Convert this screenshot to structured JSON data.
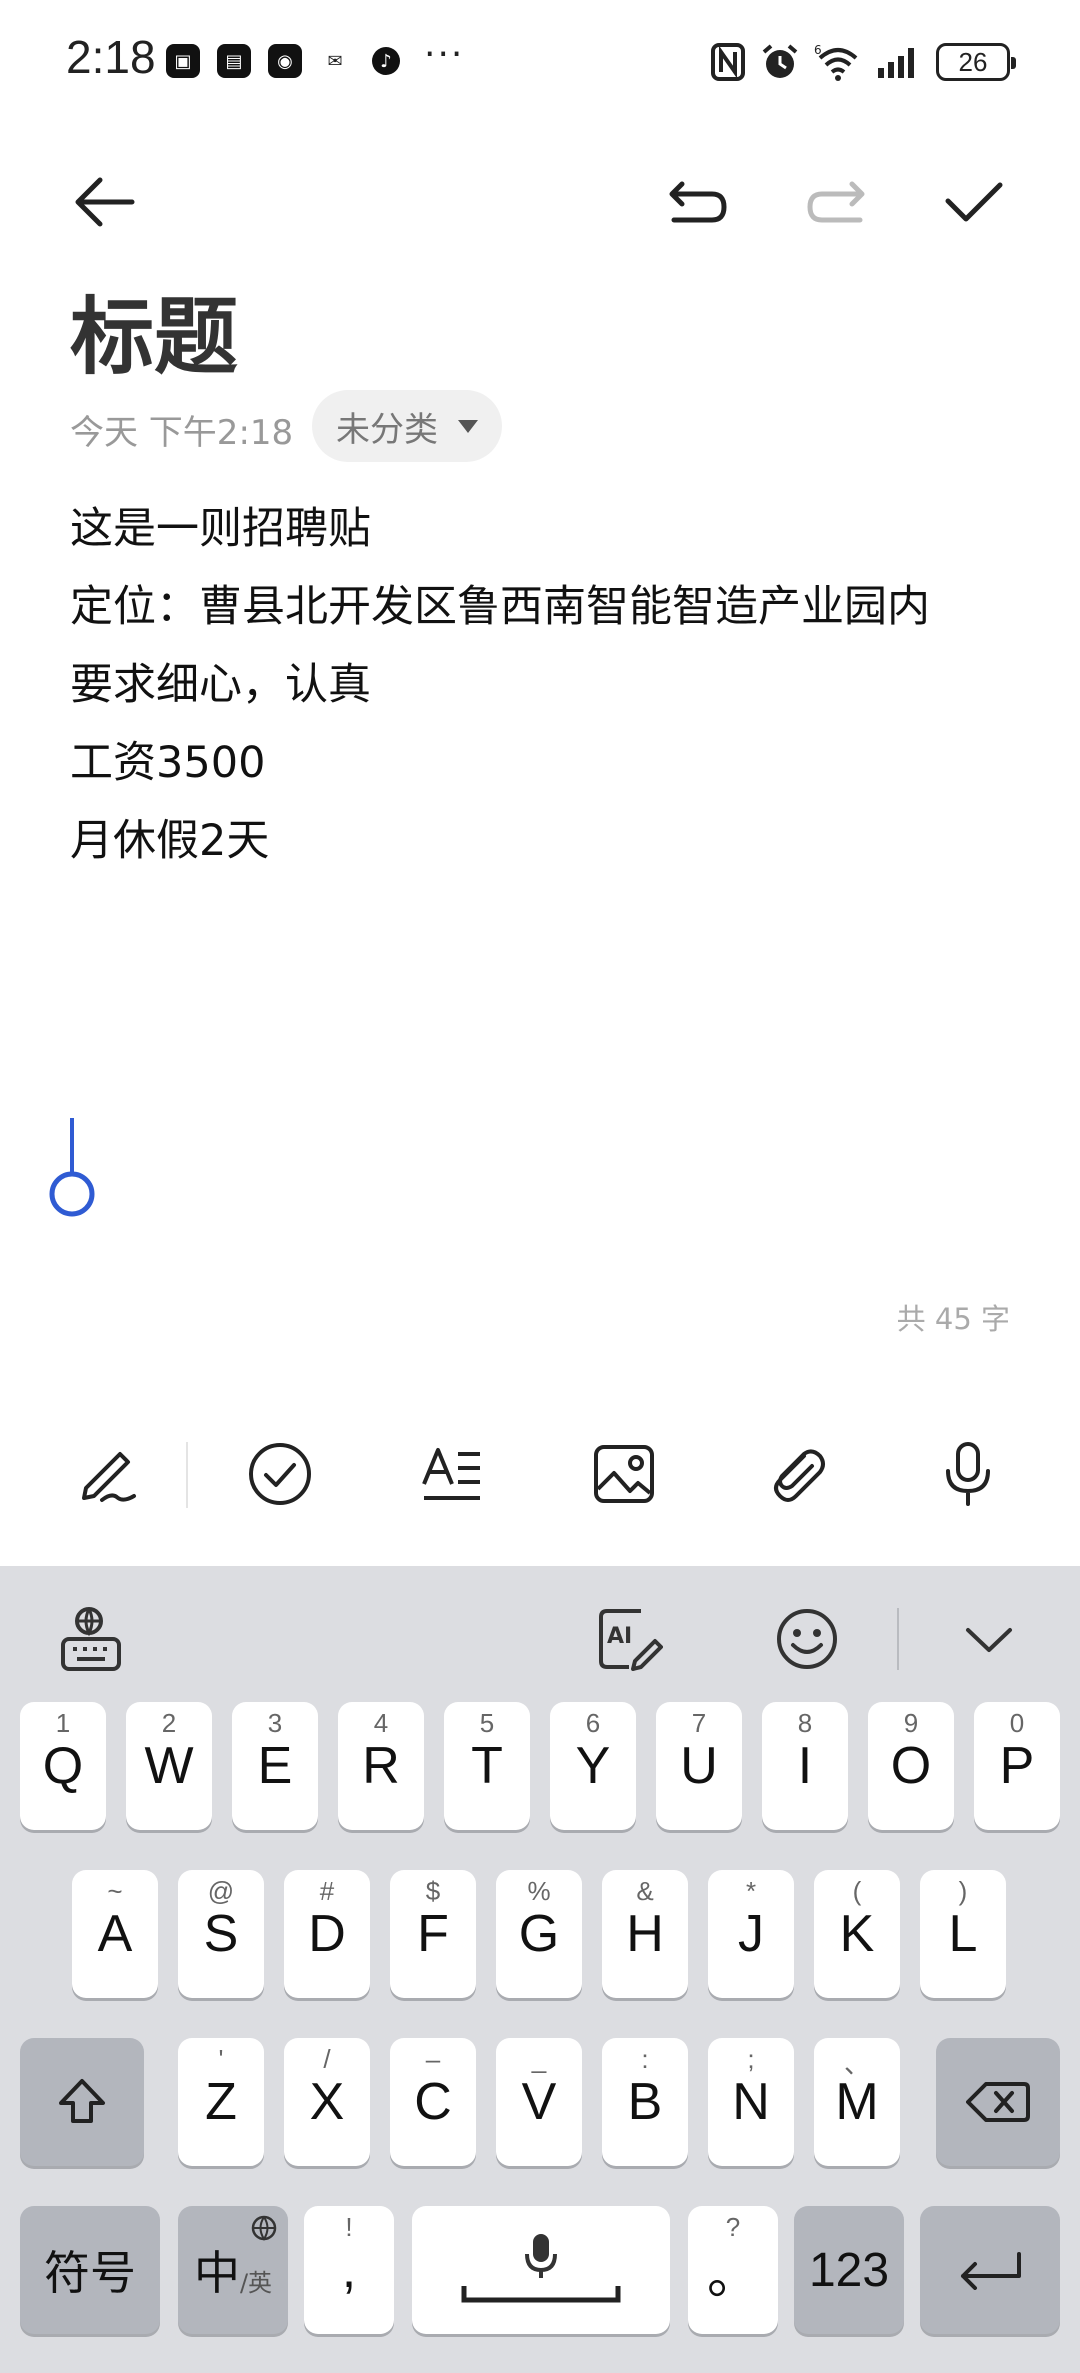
{
  "status_bar": {
    "time": "2:18",
    "apps": [
      "▣",
      "▤",
      "◉",
      "✉",
      "♪"
    ],
    "more": "···",
    "battery": "26"
  },
  "toolbar": {
    "back_icon": "arrow-left-icon",
    "undo_icon": "undo-icon",
    "redo_icon": "redo-icon",
    "done_icon": "checkmark-icon"
  },
  "note": {
    "title": "标题",
    "date": "今天 下午2:18",
    "category": "未分类",
    "lines": [
      "这是一则招聘贴",
      "定位：曹县北开发区鲁西南智能智造产业园内",
      "要求细心，认真",
      "工资3500",
      "月休假2天"
    ],
    "word_count": "共 45 字"
  },
  "format_bar": {
    "icons": [
      "handwriting-icon",
      "checklist-icon",
      "text-style-icon",
      "image-icon",
      "attachment-icon",
      "microphone-icon"
    ]
  },
  "keyboard": {
    "tools": [
      "keyboard-settings-icon",
      "ai-writing-icon",
      "emoji-icon",
      "collapse-keyboard-icon"
    ],
    "row1": [
      {
        "main": "Q",
        "sub": "1"
      },
      {
        "main": "W",
        "sub": "2"
      },
      {
        "main": "E",
        "sub": "3"
      },
      {
        "main": "R",
        "sub": "4"
      },
      {
        "main": "T",
        "sub": "5"
      },
      {
        "main": "Y",
        "sub": "6"
      },
      {
        "main": "U",
        "sub": "7"
      },
      {
        "main": "I",
        "sub": "8"
      },
      {
        "main": "O",
        "sub": "9"
      },
      {
        "main": "P",
        "sub": "0"
      }
    ],
    "row2": [
      {
        "main": "A",
        "sub": "~"
      },
      {
        "main": "S",
        "sub": "@"
      },
      {
        "main": "D",
        "sub": "#"
      },
      {
        "main": "F",
        "sub": "$"
      },
      {
        "main": "G",
        "sub": "%"
      },
      {
        "main": "H",
        "sub": "&"
      },
      {
        "main": "J",
        "sub": "*"
      },
      {
        "main": "K",
        "sub": "("
      },
      {
        "main": "L",
        "sub": ")"
      }
    ],
    "row3": [
      {
        "main": "Z",
        "sub": "'"
      },
      {
        "main": "X",
        "sub": "/"
      },
      {
        "main": "C",
        "sub": "–"
      },
      {
        "main": "V",
        "sub": "_"
      },
      {
        "main": "B",
        "sub": ":"
      },
      {
        "main": "N",
        "sub": ";"
      },
      {
        "main": "M",
        "sub": "、"
      }
    ],
    "symbols": "符号",
    "lang_main": "中",
    "lang_sub": "/英",
    "comma": ",",
    "comma_sub": "!",
    "period": "。",
    "period_sub": "?",
    "numbers": "123"
  }
}
